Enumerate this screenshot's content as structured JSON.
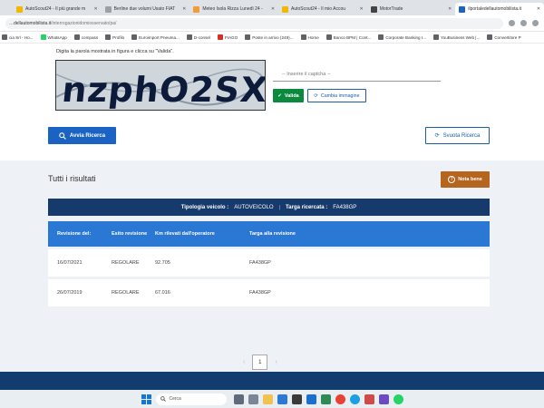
{
  "browser": {
    "tabs": [
      {
        "label": "AutoScout24 - Il più grande m",
        "active": false
      },
      {
        "label": "Berline due volumi Usato FIAT",
        "active": false
      },
      {
        "label": "Meteo Isola Rizza Lunedì 24 -",
        "active": false
      },
      {
        "label": "AutoScout24 - Il mio Accou",
        "active": false
      },
      {
        "label": "MotorTrade",
        "active": false
      },
      {
        "label": "ilportaledellautomobilista.it",
        "active": true
      }
    ],
    "url_host": "…dellautomobilista.it",
    "url_path": "/interrogazionidomiosservato/pa/",
    "bookmarks": [
      "cia Srl - Ho...",
      "WhatsApp",
      "compass",
      "Profilo",
      "Euroimport Pneuma...",
      "D-consel",
      "FIAGO",
      "Poste in arrivo (249)...",
      "Home",
      "Banco BPM | Cont...",
      "Corporate Banking I...",
      "YouBusiness Web |...",
      "Convertitore P"
    ]
  },
  "captcha": {
    "hint": "Digita la parola mostrata in figura e clicca su \"Valida\".",
    "text": "nzphO2SX",
    "placeholder": "-- Inserire il captcha --",
    "validate_label": "Valida",
    "change_label": "Cambia immagine"
  },
  "search": {
    "start_label": "Avvia Ricerca",
    "clear_label": "Svuota Ricerca"
  },
  "results": {
    "title": "Tutti i risultati",
    "note_label": "Nota bene",
    "vehicle_type_label": "Tipologia veicolo :",
    "vehicle_type_value": "AUTOVEICOLO",
    "plate_label": "Targa ricercata :",
    "plate_value": "FA438GP",
    "columns": [
      "Revisione del:",
      "Esito revisione",
      "Km rilevati dall'operatore",
      "Targa alla revisione"
    ],
    "rows": [
      {
        "date": "16/07/2021",
        "outcome": "REGOLARE",
        "km": "92.705",
        "plate": "FA438GP"
      },
      {
        "date": "26/07/2019",
        "outcome": "REGOLARE",
        "km": "67.016",
        "plate": "FA438GP"
      }
    ],
    "page": "1"
  },
  "taskbar": {
    "search_placeholder": "Cerca"
  },
  "colors": {
    "primary": "#1a63c2",
    "dark_navy": "#163a6b",
    "success": "#0b8a3e",
    "warning": "#b5651d"
  }
}
